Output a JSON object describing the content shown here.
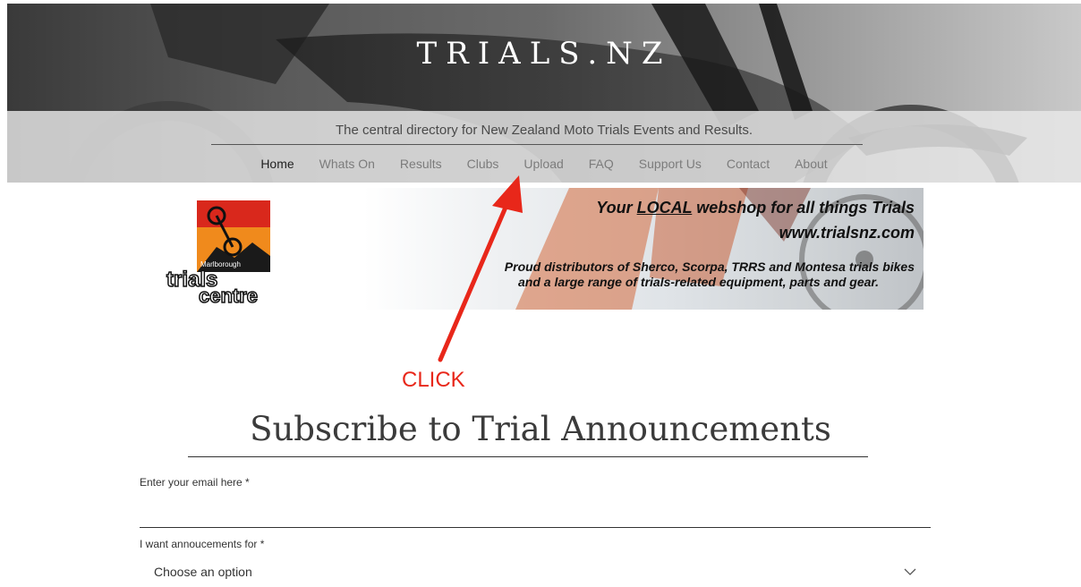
{
  "header": {
    "site_title": "TRIALS.NZ",
    "tagline": "The central directory for New Zealand Moto Trials Events and Results.",
    "nav": [
      {
        "label": "Home",
        "active": true
      },
      {
        "label": "Whats On"
      },
      {
        "label": "Results"
      },
      {
        "label": "Clubs"
      },
      {
        "label": "Upload"
      },
      {
        "label": "FAQ"
      },
      {
        "label": "Support Us"
      },
      {
        "label": "Contact"
      },
      {
        "label": "About"
      }
    ]
  },
  "banner": {
    "logo_text_top": "Marlborough",
    "logo_text_main": "trials",
    "logo_text_sub": "centre",
    "line1_pre": "Your ",
    "line1_emph": "LOCAL",
    "line1_post": " webshop for all things Trials",
    "line2": "www.trialsnz.com",
    "line3": "Proud distributors of Sherco, Scorpa, TRRS and Montesa trials bikes",
    "line4": "and a large range of trials-related equipment, parts and gear."
  },
  "annotation": {
    "label": "CLICK",
    "color": "#e8271a"
  },
  "subscribe": {
    "title": "Subscribe to Trial Announcements",
    "email_label": "Enter your email here *",
    "email_value": "",
    "select_label": "I want annoucements for *",
    "select_value": "Choose an option"
  },
  "colors": {
    "accent": "#e8271a",
    "text_dark": "#333333",
    "nav_inactive": "#7c7c7c"
  },
  "icons": {
    "select": "chevron-down-icon"
  }
}
